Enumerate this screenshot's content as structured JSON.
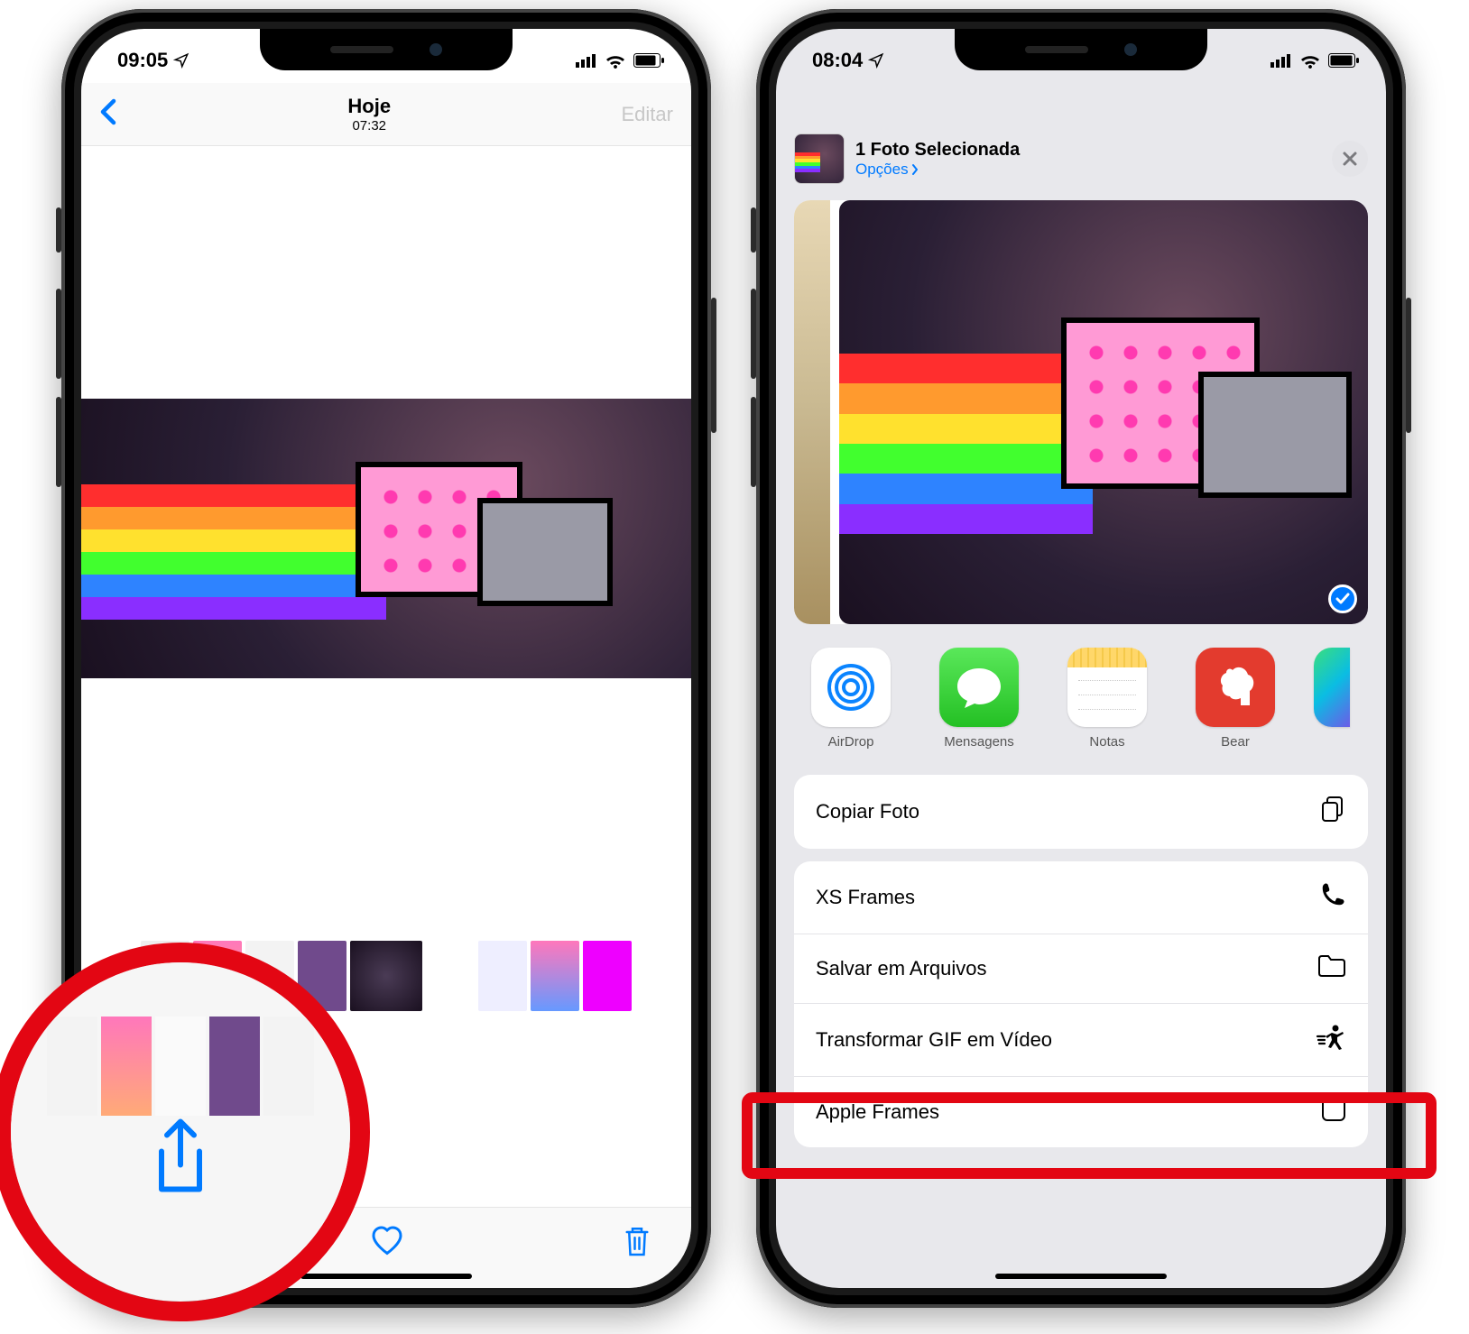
{
  "left": {
    "status": {
      "time": "09:05"
    },
    "nav": {
      "title": "Hoje",
      "subtitle": "07:32",
      "edit": "Editar"
    }
  },
  "right": {
    "status": {
      "time": "08:04"
    },
    "header": {
      "title": "1 Foto Selecionada",
      "options": "Opções"
    },
    "apps": [
      {
        "label": "AirDrop"
      },
      {
        "label": "Mensagens"
      },
      {
        "label": "Notas"
      },
      {
        "label": "Bear"
      }
    ],
    "actions": [
      {
        "label": "Copiar Foto",
        "icon": "copy"
      },
      {
        "label": "XS Frames",
        "icon": "phone"
      },
      {
        "label": "Salvar em Arquivos",
        "icon": "folder"
      },
      {
        "label": "Transformar GIF em Vídeo",
        "icon": "shortcut"
      },
      {
        "label": "Apple Frames",
        "icon": "shortcut-box"
      }
    ]
  }
}
